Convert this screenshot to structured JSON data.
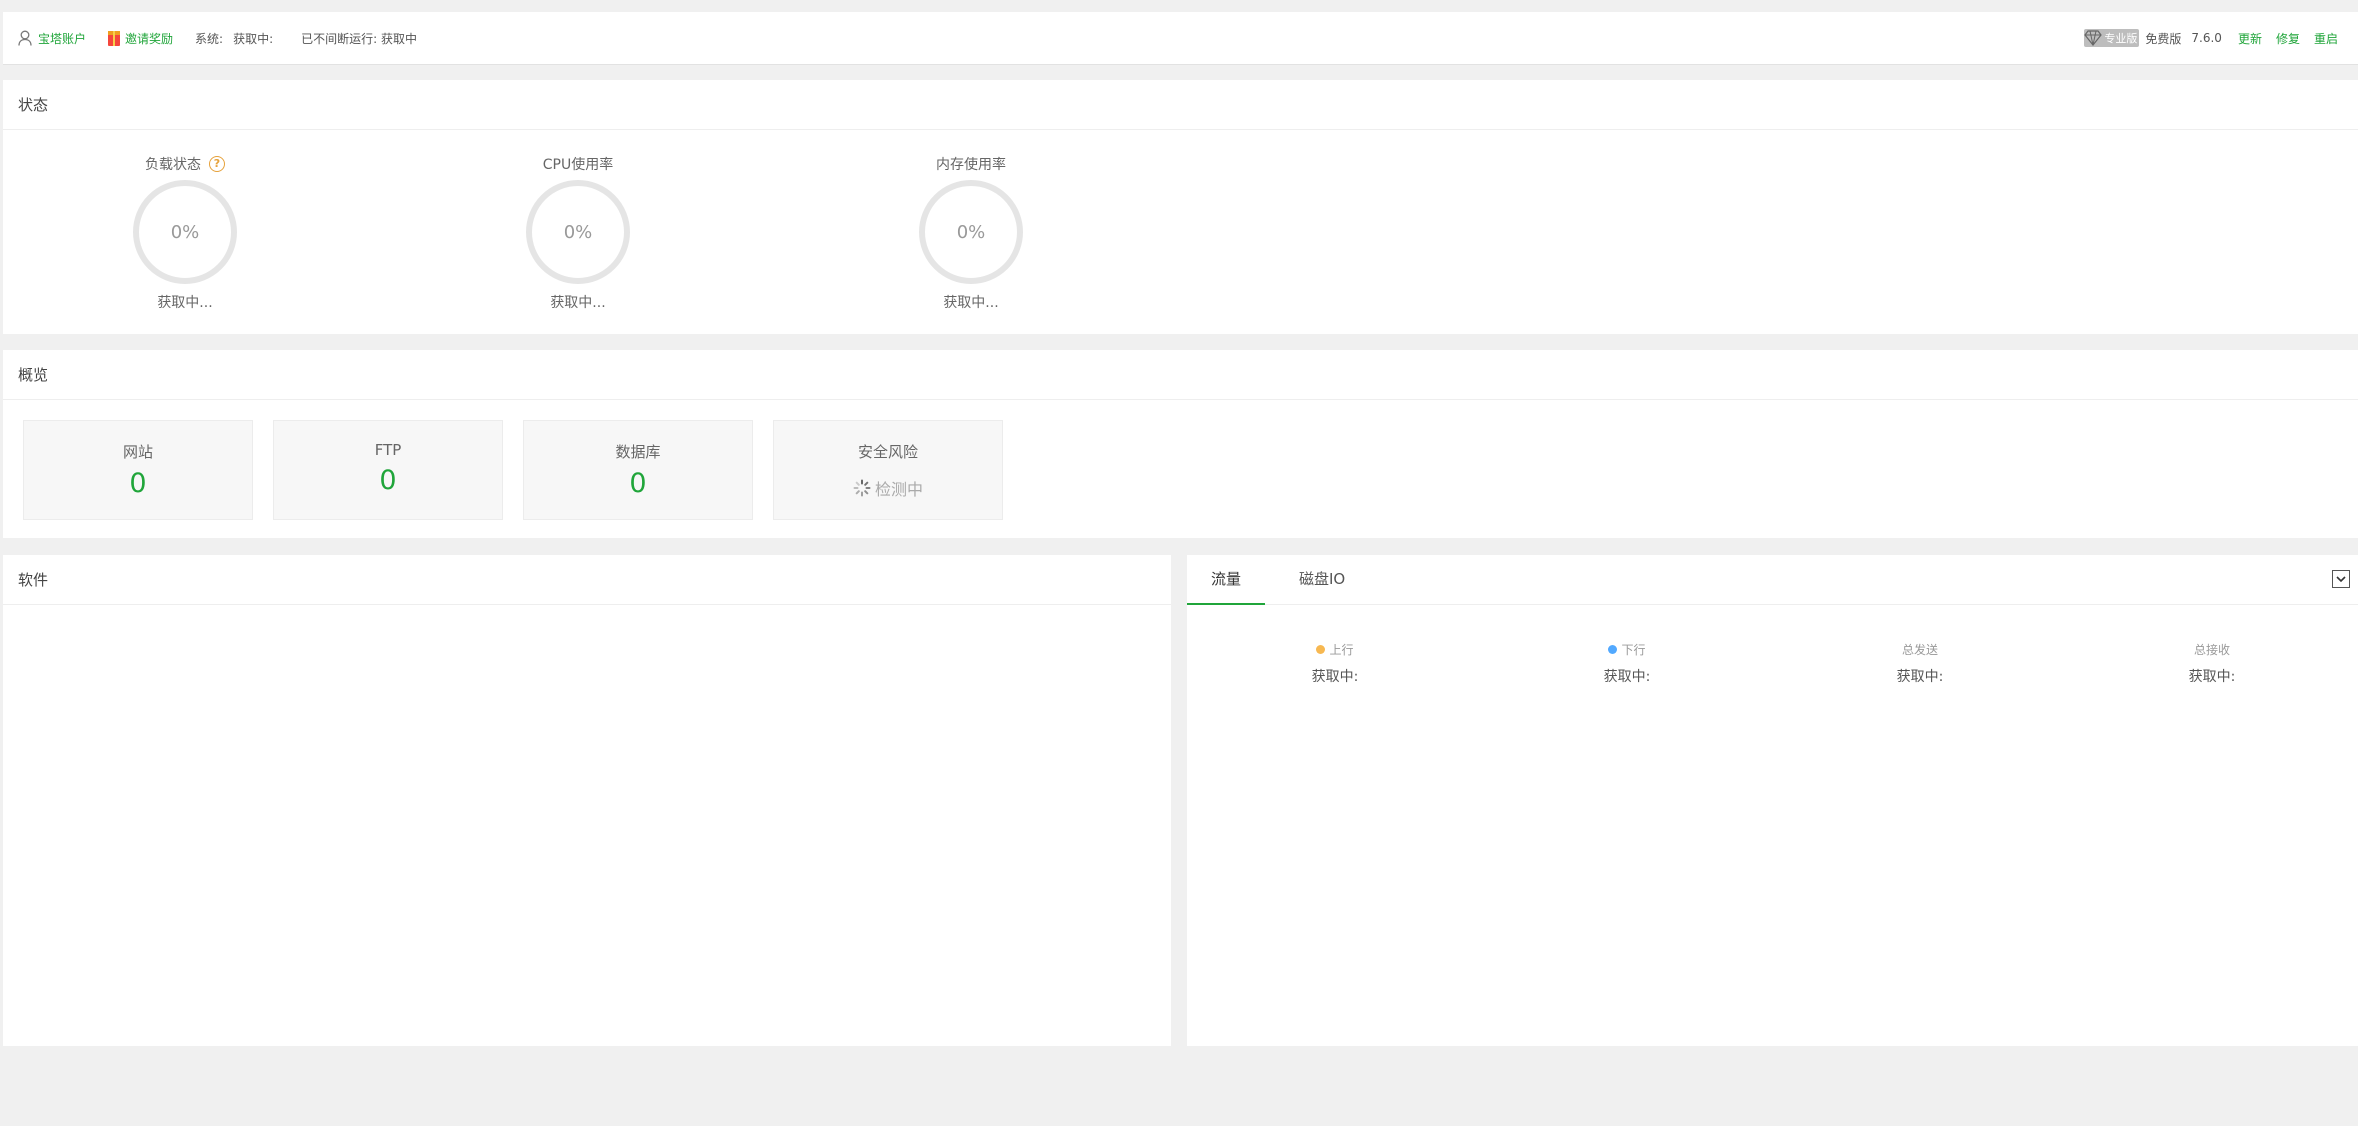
{
  "topbar": {
    "account": "宝塔账户",
    "invite": "邀请奖励",
    "system_label": "系统:",
    "system_value": "获取中:",
    "uptime": "已不间断运行: 获取中",
    "pro_badge": "专业版",
    "edition": "免费版",
    "version": "7.6.0",
    "update": "更新",
    "repair": "修复",
    "restart": "重启"
  },
  "status": {
    "title": "状态",
    "gauges": [
      {
        "title": "负载状态",
        "value": "0%",
        "sub": "获取中..."
      },
      {
        "title": "CPU使用率",
        "value": "0%",
        "sub": "获取中..."
      },
      {
        "title": "内存使用率",
        "value": "0%",
        "sub": "获取中..."
      }
    ],
    "help_glyph": "?"
  },
  "overview": {
    "title": "概览",
    "cards": [
      {
        "label": "网站",
        "value": "0"
      },
      {
        "label": "FTP",
        "value": "0"
      },
      {
        "label": "数据库",
        "value": "0"
      },
      {
        "label": "安全风险",
        "value": "检测中"
      }
    ]
  },
  "software": {
    "title": "软件"
  },
  "traffic": {
    "tabs": [
      "流量",
      "磁盘IO"
    ],
    "items": [
      {
        "label": "上行",
        "value": "获取中:"
      },
      {
        "label": "下行",
        "value": "获取中:"
      },
      {
        "label": "总发送",
        "value": "获取中:"
      },
      {
        "label": "总接收",
        "value": "获取中:"
      }
    ]
  },
  "colors": {
    "accent": "#20a53a",
    "upstream": "#f7b851",
    "downstream": "#52a9ff",
    "help": "#e6a23c"
  },
  "icons": [
    "user-icon",
    "gift-icon",
    "diamond-icon",
    "help-icon",
    "spinner-icon",
    "chevron-down-icon"
  ]
}
